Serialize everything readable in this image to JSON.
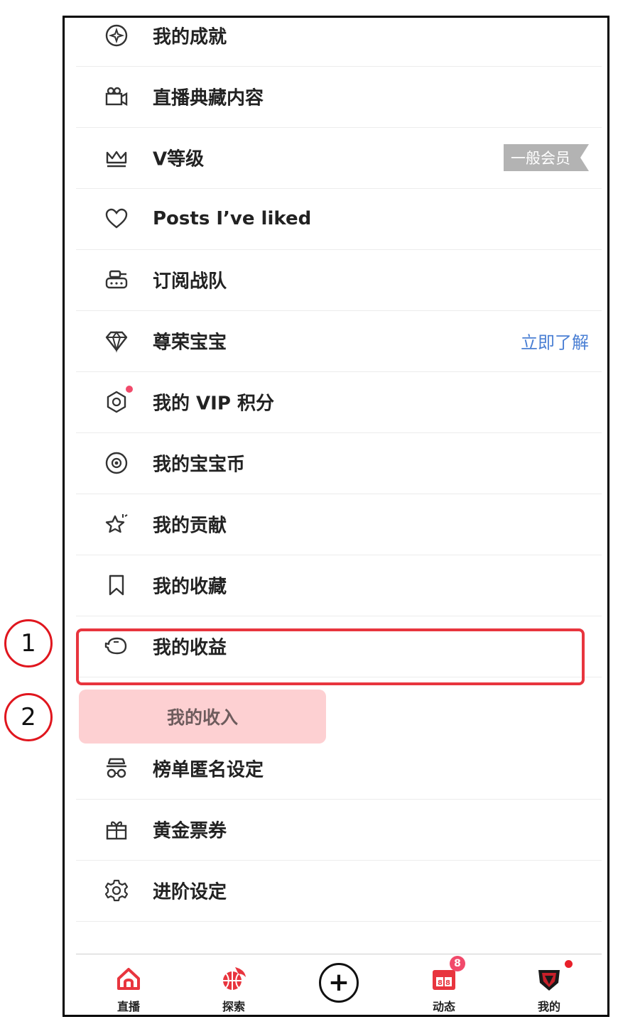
{
  "menu": {
    "items": [
      {
        "label": "我的成就",
        "icon": "achievement-icon"
      },
      {
        "label": "直播典藏内容",
        "icon": "video-camera-icon"
      },
      {
        "label": "V等级",
        "icon": "crown-icon",
        "badge": "一般会员"
      },
      {
        "label": "Posts I’ve liked",
        "icon": "heart-icon"
      },
      {
        "label": "订阅战队",
        "icon": "tank-icon"
      },
      {
        "label": "尊荣宝宝",
        "icon": "diamond-icon",
        "link": "立即了解"
      },
      {
        "label": "我的 VIP 积分",
        "icon": "vip-points-icon"
      },
      {
        "label": "我的宝宝币",
        "icon": "coin-icon"
      },
      {
        "label": "我的贡献",
        "icon": "star-icon"
      },
      {
        "label": "我的收藏",
        "icon": "bookmark-icon"
      },
      {
        "label": "我的收益",
        "icon": "piggy-bank-icon"
      },
      {
        "label": "榜单匿名设定",
        "icon": "anonymous-icon"
      },
      {
        "label": "黄金票券",
        "icon": "gift-icon"
      },
      {
        "label": "进阶设定",
        "icon": "settings-gear-icon"
      }
    ]
  },
  "annotation": {
    "marker_1": "1",
    "marker_2": "2",
    "tooltip": "我的收入"
  },
  "tabbar": {
    "tabs": [
      {
        "label": "直播",
        "icon": "home-icon"
      },
      {
        "label": "探索",
        "icon": "basketball-fire-icon"
      },
      {
        "label": "",
        "icon": "plus-icon"
      },
      {
        "label": "动态",
        "icon": "calendar-icon",
        "count": "8"
      },
      {
        "label": "我的",
        "icon": "team-avatar-icon"
      }
    ]
  },
  "colors": {
    "accent": "#e8353e",
    "link": "#4a7fd4",
    "badge": "#f14a6b"
  }
}
